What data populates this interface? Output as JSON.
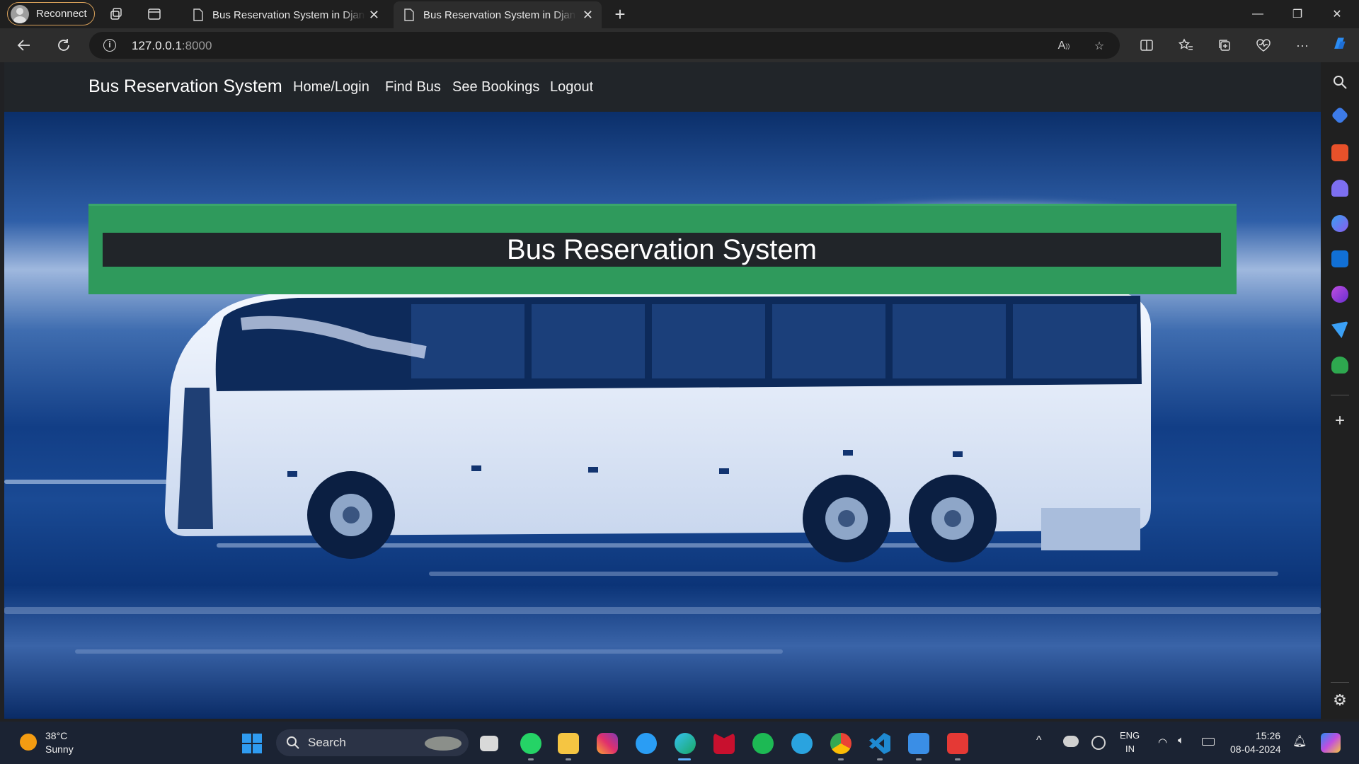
{
  "browser": {
    "profile_label": "Reconnect",
    "tabs": [
      {
        "title": "Bus Reservation System in Django"
      },
      {
        "title": "Bus Reservation System in Django"
      }
    ],
    "new_tab": "+",
    "address": {
      "host": "127.0.0.1",
      "port": ":8000"
    }
  },
  "page": {
    "navbar": {
      "brand": "Bus Reservation System",
      "links": [
        "Home/Login",
        "Find Bus",
        "See Bookings",
        "Logout"
      ]
    },
    "jumbotron_title": "Bus Reservation System",
    "colors": {
      "navbar": "#212529",
      "jumbotron": "#2f9a5c",
      "hero_blue": "#1a4a94"
    }
  },
  "taskbar": {
    "weather": {
      "temp": "38°C",
      "condition": "Sunny"
    },
    "search_placeholder": "Search",
    "tray": {
      "lang": "ENG",
      "region": "IN",
      "time": "15:26",
      "date": "08-04-2024"
    }
  }
}
